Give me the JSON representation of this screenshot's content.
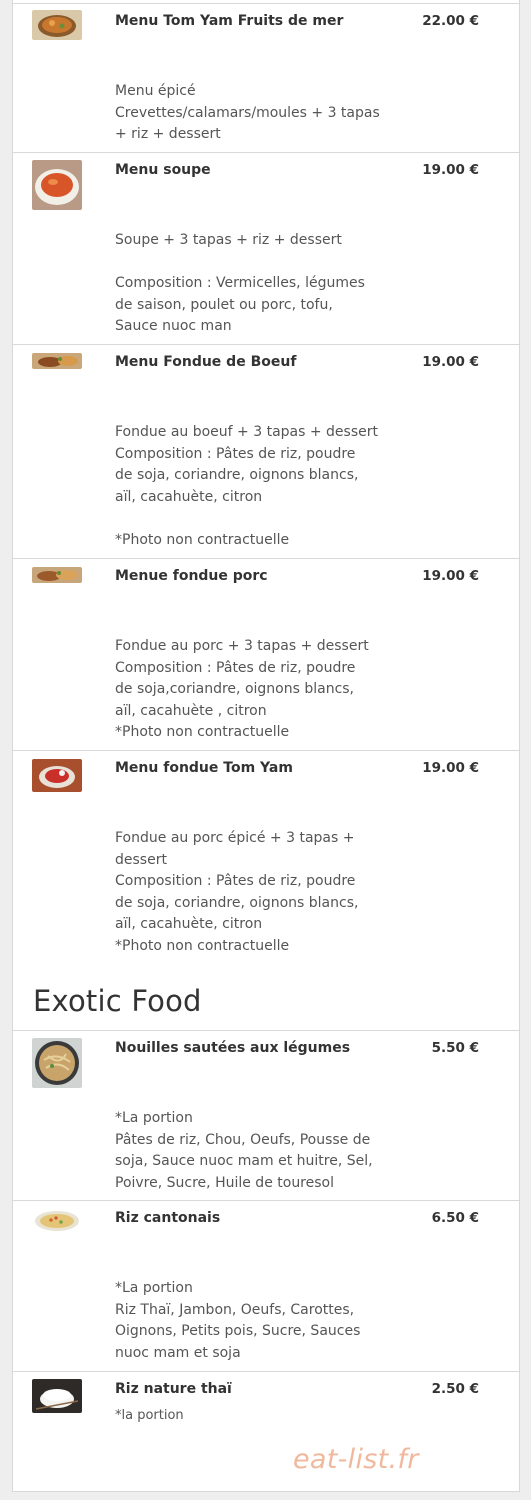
{
  "section_title": "Exotic Food",
  "watermark": "eat-list.fr",
  "items": [
    {
      "name": "Menu Tom Yam Fruits de mer",
      "price": "22.00 €",
      "image_icon": "tom-yam-seafood-bowl-photo",
      "desc": [
        "Menu épicé",
        "Crevettes/calamars/moules + 3 tapas",
        "+ riz + dessert"
      ]
    },
    {
      "name": "Menu soupe",
      "price": "19.00 €",
      "image_icon": "soup-bowl-photo",
      "desc": [
        "Soupe + 3 tapas + riz + dessert",
        "",
        "Composition : Vermicelles, légumes",
        "de saison, poulet ou porc, tofu,",
        "Sauce nuoc man"
      ]
    },
    {
      "name": "Menu Fondue de Boeuf",
      "price": "19.00 €",
      "image_icon": "beef-fondue-photo",
      "desc": [
        "Fondue au boeuf + 3 tapas + dessert",
        "Composition : Pâtes de riz, poudre",
        "de soja, coriandre, oignons blancs,",
        "aïl, cacahuète, citron",
        "",
        "*Photo non contractuelle"
      ]
    },
    {
      "name": "Menue fondue porc",
      "price": "19.00 €",
      "image_icon": "pork-fondue-photo",
      "desc": [
        "Fondue au porc + 3 tapas + dessert",
        "Composition : Pâtes de riz, poudre",
        "de soja,coriandre, oignons blancs,",
        "aïl, cacahuète , citron",
        "*Photo non contractuelle"
      ]
    },
    {
      "name": "Menu fondue Tom Yam",
      "price": "19.00 €",
      "image_icon": "tom-yam-fondue-photo",
      "desc": [
        "Fondue au porc épicé + 3 tapas +",
        "dessert",
        "Composition : Pâtes de riz, poudre",
        "de soja, coriandre, oignons blancs,",
        "aïl, cacahuète, citron",
        "*Photo non contractuelle"
      ]
    },
    {
      "name": "Nouilles sautées aux légumes",
      "price": "5.50 €",
      "image_icon": "sauteed-noodles-photo",
      "desc": [
        "*La portion",
        "Pâtes de riz, Chou, Oeufs, Pousse de",
        "soja, Sauce nuoc mam et huitre, Sel,",
        "Poivre, Sucre, Huile de touresol"
      ]
    },
    {
      "name": "Riz cantonais",
      "price": "6.50 €",
      "image_icon": "cantonese-rice-photo",
      "desc": [
        "*La portion",
        "Riz Thaï, Jambon, Oeufs, Carottes,",
        "Oignons, Petits pois, Sucre, Sauces",
        "nuoc mam et soja"
      ]
    },
    {
      "name": "Riz nature thaï",
      "price": "2.50 €",
      "image_icon": "plain-rice-bowl-photo",
      "desc": [
        "*la portion"
      ]
    }
  ],
  "colors": {
    "background": "#eeeeee",
    "panel": "#ffffff",
    "text": "#333333",
    "divider": "#d9d9d9",
    "watermark": "#f0b89c"
  }
}
